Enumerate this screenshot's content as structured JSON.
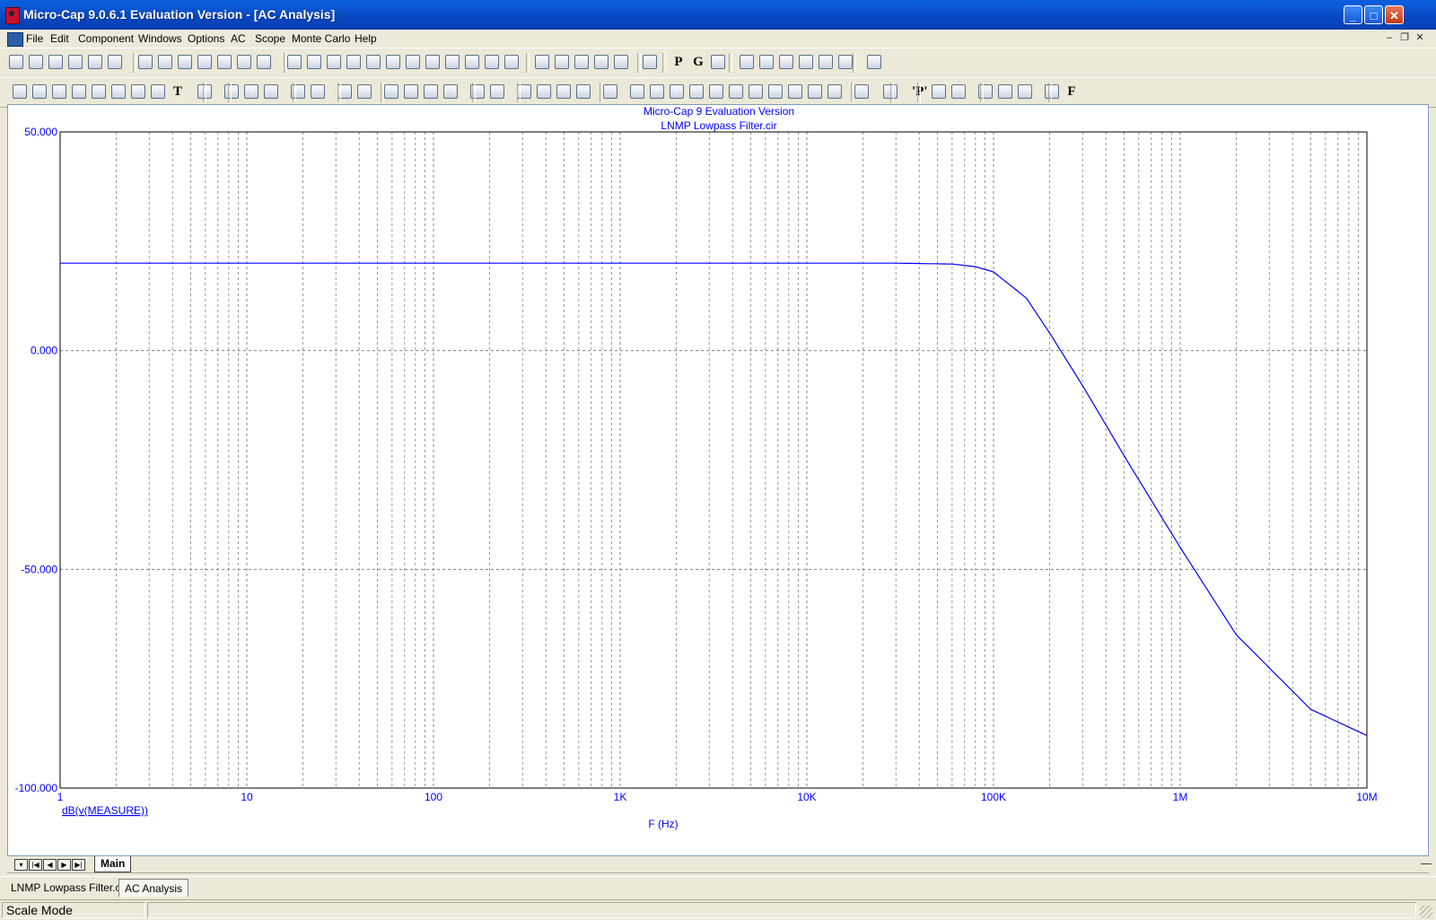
{
  "window": {
    "title": "Micro-Cap 9.0.6.1 Evaluation Version - [AC Analysis]",
    "minimize_glyph": "_",
    "maximize_glyph": "□",
    "close_glyph": "✕"
  },
  "menubar": {
    "items": [
      "File",
      "Edit",
      "Component",
      "Windows",
      "Options",
      "AC",
      "Scope",
      "Monte Carlo",
      "Help"
    ],
    "mdi_minimize": "–",
    "mdi_restore": "❐",
    "mdi_close": "✕"
  },
  "toolbar1": {
    "icons": [
      "new-file-icon",
      "open-folder-icon",
      "save-icon",
      "save-all-icon",
      "print-icon",
      "print-preview-icon",
      "undo-icon",
      "redo-icon",
      "cut-icon",
      "copy-icon",
      "paste-icon",
      "delete-icon",
      "select-all-icon",
      "ground-icon",
      "resistor-icon",
      "capacitor-icon",
      "inductor-icon",
      "diode-icon",
      "battery-icon",
      "transistor-icon",
      "opamp-icon",
      "resistor-box-icon",
      "wire-icon",
      "node-icon",
      "voltage-source-icon",
      "split-horizontal-icon",
      "split-vertical-icon",
      "cascade-icon",
      "tile-icon",
      "tile-vertical-icon",
      "calculator-icon",
      "letter-p-icon",
      "letter-g-icon",
      "properties-icon",
      "component-list-icon",
      "waveform-icon",
      "probe-icon",
      "pen-icon",
      "active-analysis-icon",
      "vto-icon",
      "zoom-window-icon"
    ],
    "p_glyph": "P",
    "g_glyph": "G"
  },
  "toolbar2": {
    "icons": [
      "select-pointer-icon",
      "shape-tool-icon",
      "graph-tool-icon",
      "graph-tool-2-icon",
      "graph-tool-3-icon",
      "graph-tool-4-icon",
      "graph-tool-5-icon",
      "graph-tool-6-icon",
      "text-tool-icon",
      "properties-dialog-icon",
      "run-icon",
      "stop-icon",
      "pause-icon",
      "line-tool-icon",
      "diagonal-line-icon",
      "graph-frame-icon",
      "graph-grid-icon",
      "grid-bold-icon",
      "grid-bolder-icon",
      "grid-minor-icon",
      "grid-dotted-icon",
      "horizontal-axis-icon",
      "axis-ticks-icon",
      "cursor-left-icon",
      "cursor-right-icon",
      "cursor-peak-icon",
      "cursor-wave-icon",
      "auto-scale-icon",
      "crosshair-left-icon",
      "crosshair-right-icon",
      "peak-icon",
      "valley-icon",
      "high-icon",
      "low-icon",
      "inflection-icon",
      "global-high-icon",
      "global-low-icon",
      "top-icon",
      "bottom-icon",
      "package-icon",
      "table-icon",
      "point-tag-icon",
      "tag-left-icon",
      "tag-right-icon",
      "zoom-in-icon",
      "zoom-out-icon",
      "zoom-fit-icon",
      "globe-icon",
      "letter-f-icon"
    ],
    "text_tool_glyph": "T",
    "point_glyph": "'P'",
    "f_glyph": "F"
  },
  "plot": {
    "title_line1": "Micro-Cap 9 Evaluation Version",
    "title_line2": "LNMP Lowpass Filter.cir",
    "y_expression": "dB(v(MEASURE))",
    "x_label": "F (Hz)",
    "y_tick_labels": [
      "50.000",
      "0.000",
      "-50.000",
      "-100.000"
    ],
    "x_tick_labels": [
      "1",
      "10",
      "100",
      "1K",
      "10K",
      "100K",
      "1M",
      "10M"
    ]
  },
  "chart_data": {
    "type": "line",
    "title": "LNMP Lowpass Filter.cir",
    "xlabel": "F (Hz)",
    "ylabel": "dB(v(MEASURE))",
    "x_scale": "log",
    "xlim": [
      1,
      10000000
    ],
    "ylim": [
      -100,
      50
    ],
    "grid": true,
    "x": [
      1,
      10,
      100,
      1000,
      10000,
      30000,
      60000,
      80000,
      100000,
      150000,
      200000,
      300000,
      500000,
      1000000,
      2000000,
      5000000,
      10000000
    ],
    "series": [
      {
        "name": "dB(v(MEASURE))",
        "color": "#0000FF",
        "values": [
          20,
          20,
          20,
          20,
          20,
          20,
          19.8,
          19.2,
          18,
          12,
          4,
          -8,
          -24,
          -45,
          -65,
          -82,
          -88
        ]
      }
    ]
  },
  "tabs": {
    "nav_buttons": [
      "▾",
      "|◀",
      "◀",
      "▶",
      "▶|"
    ],
    "sheet_tab": "Main",
    "doc_tabs": [
      "LNMP Lowpass Filter.cir",
      "AC Analysis"
    ]
  },
  "status": {
    "mode": "Scale Mode"
  },
  "colors": {
    "accent": "#0000FF",
    "titlebar": "#0A5FE0",
    "grid": "#808080"
  }
}
